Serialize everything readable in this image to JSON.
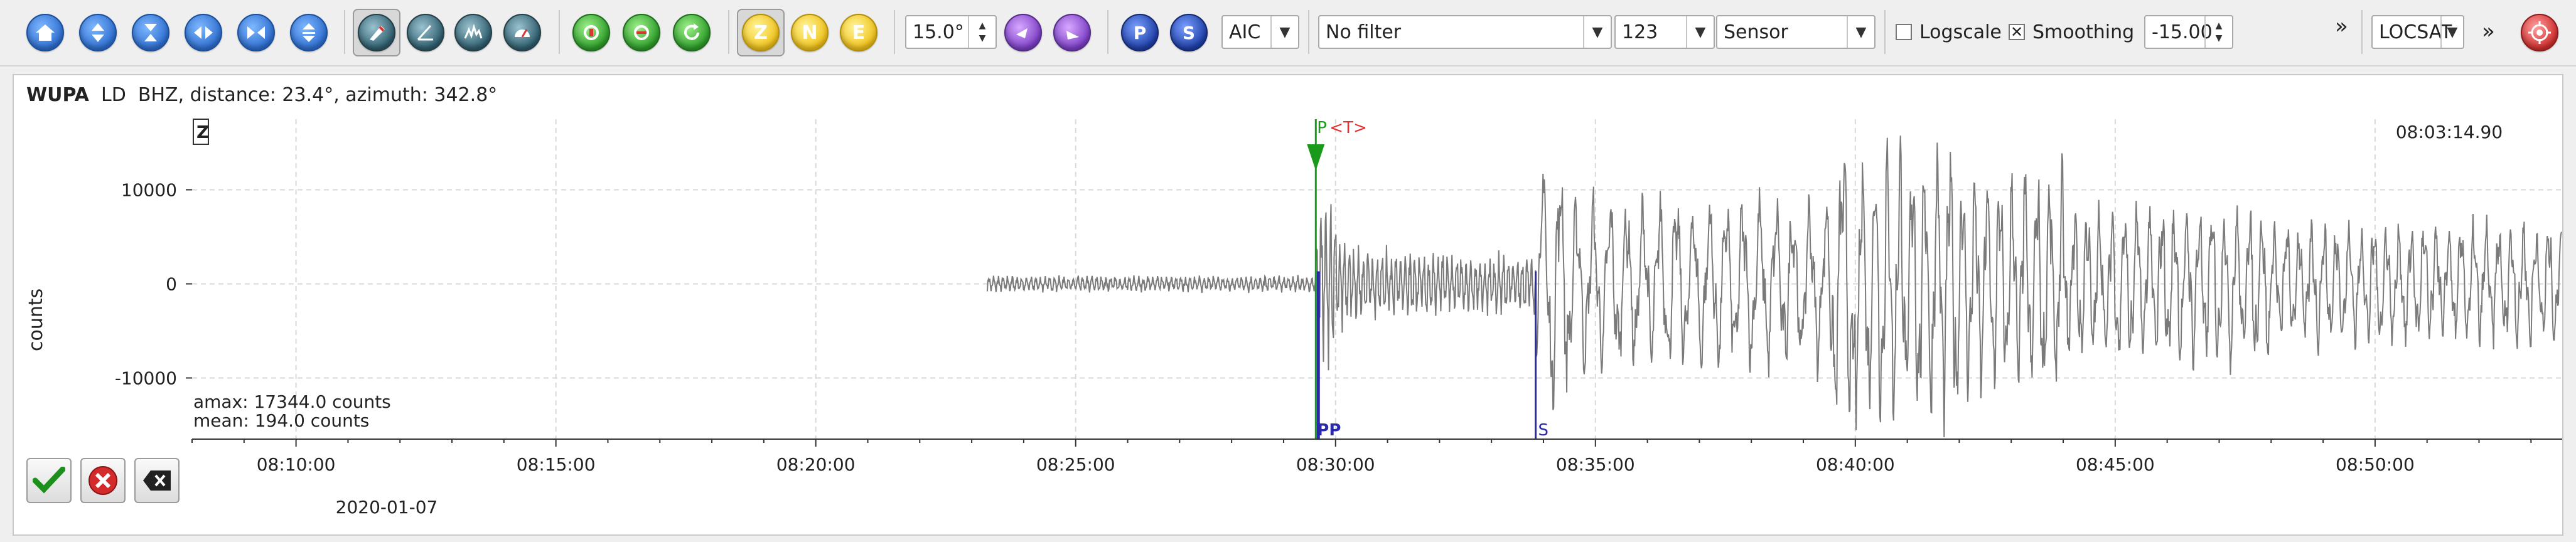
{
  "toolbar": {
    "zoom_in_icon": "zoom-in-icon",
    "filter_angle": "15.0°",
    "picker": "AIC",
    "filter": "No filter",
    "components": "123",
    "unit": "Sensor",
    "logscale_label": "Logscale",
    "logscale_checked": false,
    "smoothing_label": "Smoothing",
    "smoothing_checked": true,
    "offset_value": "-15.00",
    "more_label": "»",
    "locator": "LOCSAT",
    "more_label2": "»",
    "btn_z": "Z",
    "btn_n": "N",
    "btn_e": "E",
    "btn_p": "P",
    "btn_s": "S"
  },
  "trace": {
    "station": "WUPA",
    "network_loc": "LD",
    "channel": "BHZ, distance: 23.4°, azimuth: 342.8°",
    "component_badge": "Z",
    "time_readout": "08:03:14.90",
    "amax": "amax: 17344.0 counts",
    "mean": "mean: 194.0 counts",
    "date": "2020-01-07",
    "y_axis_label": "counts"
  },
  "chart_data": {
    "type": "line",
    "ylabel": "counts",
    "yticks": [
      10000,
      0,
      -10000
    ],
    "ytick_labels": [
      "10000",
      "0",
      "-10000"
    ],
    "ylim": [
      -16500,
      17500
    ],
    "xlim_minutes": [
      8.0,
      53.6
    ],
    "xticks_minutes": [
      10,
      15,
      20,
      25,
      30,
      35,
      40,
      45,
      50
    ],
    "xtick_labels": [
      "08:10:00",
      "08:15:00",
      "08:20:00",
      "08:25:00",
      "08:30:00",
      "08:35:00",
      "08:40:00",
      "08:45:00",
      "08:50:00"
    ],
    "grid": true,
    "signal_start_minutes": 23.3,
    "picks": [
      {
        "label": "P",
        "time_minutes": 29.62,
        "color": "#1a9a1a",
        "position": "top"
      },
      {
        "label": "<T>",
        "time_minutes": 29.62,
        "color": "#e03030",
        "position": "top"
      },
      {
        "label": "PP",
        "time_minutes": 29.62,
        "color": "#2a2aa8",
        "position": "bottom"
      },
      {
        "label": "S",
        "time_minutes": 33.85,
        "color": "#2a2aa8",
        "position": "bottom"
      }
    ]
  }
}
